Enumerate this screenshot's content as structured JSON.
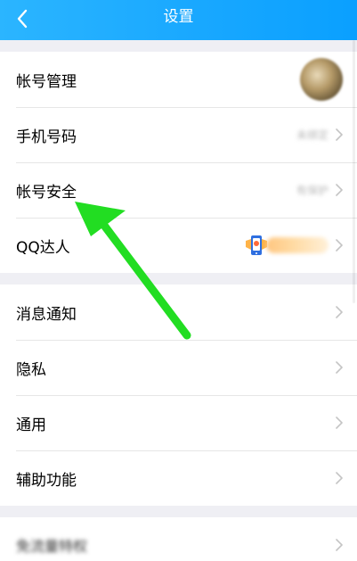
{
  "header": {
    "title": "设置",
    "back_icon": "back-arrow-icon",
    "background": "#19a8ff"
  },
  "sections": [
    {
      "items": [
        {
          "label": "帐号管理",
          "trailing": "avatar"
        },
        {
          "label": "手机号码",
          "value": "未绑定"
        },
        {
          "label": "帐号安全",
          "value": "有保护"
        },
        {
          "label": "QQ达人",
          "value": "持续中",
          "icon": "phone-badge-icon"
        }
      ]
    },
    {
      "items": [
        {
          "label": "消息通知"
        },
        {
          "label": "隐私"
        },
        {
          "label": "通用"
        },
        {
          "label": "辅助功能"
        }
      ]
    },
    {
      "items": [
        {
          "label": "免流量特权"
        }
      ]
    }
  ],
  "annotation": {
    "type": "green-arrow",
    "color": "#22dd22",
    "points_to": "帐号安全"
  },
  "colors": {
    "page_bg": "#efeff4",
    "row_bg": "#ffffff",
    "divider": "#e6e6e6",
    "chevron": "#c4c4c4"
  }
}
